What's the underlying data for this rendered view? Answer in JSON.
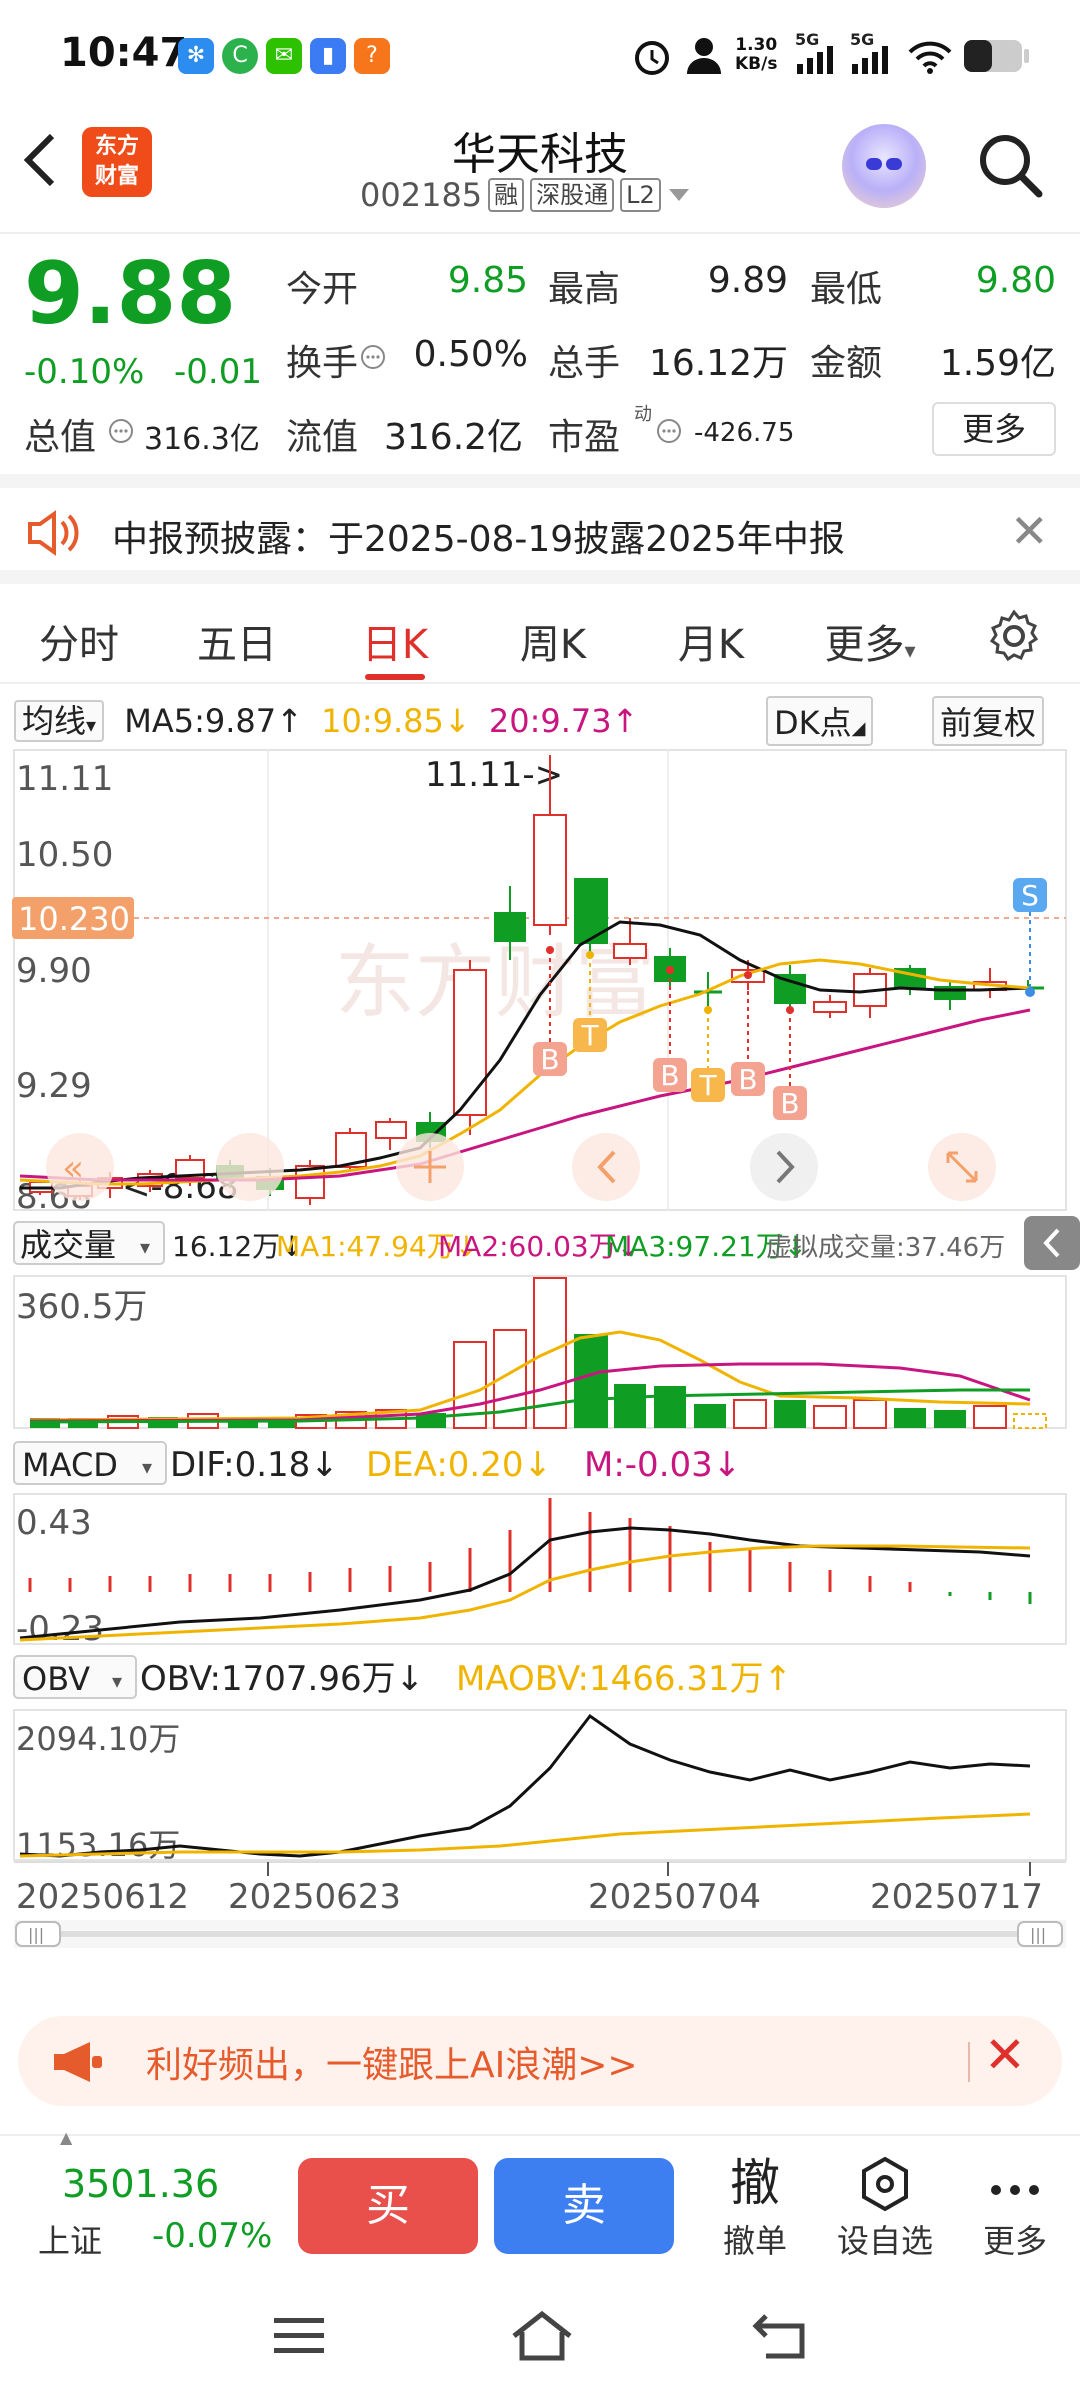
{
  "status_bar": {
    "time": "10:47",
    "net_speed": "1.30",
    "net_unit": "KB/s",
    "sig1": "5G",
    "sig2": "5G"
  },
  "header": {
    "logo_line1": "东方",
    "logo_line2": "财富",
    "name": "华天科技",
    "code": "002185",
    "tags": [
      "融",
      "深股通",
      "L2"
    ]
  },
  "quote": {
    "price": "9.88",
    "change_pct": "-0.10%",
    "change_abs": "-0.01",
    "fields": [
      {
        "label": "今开",
        "value": "9.85",
        "color": "green"
      },
      {
        "label": "最高",
        "value": "9.89",
        "color": "black"
      },
      {
        "label": "最低",
        "value": "9.80",
        "color": "green"
      },
      {
        "label": "换手",
        "value": "0.50%",
        "color": "black"
      },
      {
        "label": "总手",
        "value": "16.12万",
        "color": "black"
      },
      {
        "label": "金额",
        "value": "1.59亿",
        "color": "black"
      }
    ],
    "total_value_label": "总值",
    "total_value": "316.3亿",
    "float_label": "流值",
    "float_value": "316.2亿",
    "pe_label": "市盈",
    "pe_sup": "动",
    "pe_value": "-426.75",
    "more": "更多"
  },
  "notice": {
    "text": "中报预披露：于2025-08-19披露2025年中报"
  },
  "tabs": [
    "分时",
    "五日",
    "日K",
    "周K",
    "月K",
    "更多"
  ],
  "active_tab": 2,
  "ma_row": {
    "selector": "均线",
    "ma5": "MA5:9.87",
    "ma10": "10:9.85",
    "ma20": "20:9.73",
    "dk": "DK点",
    "adj": "前复权"
  },
  "kline": {
    "ymax_label": "11.11",
    "y2_label": "10.50",
    "y3_label": "9.90",
    "y4_label": "9.29",
    "y5_label": "8.68",
    "peak_note": "11.11->",
    "low_note": "<-8.68",
    "crosshair_price": "10.230",
    "markers": [
      "B",
      "T",
      "B",
      "T",
      "B",
      "B"
    ],
    "s_marker": "S"
  },
  "volume_row": {
    "selector": "成交量",
    "vol": "16.12万",
    "ma1": "MA1:47.94万",
    "ma2": "MA2:60.03万",
    "ma3": "MA3:97.21万",
    "virtual": "虚拟成交量:37.46万",
    "ymax": "360.5万"
  },
  "macd_row": {
    "selector": "MACD",
    "dif": "DIF:0.18",
    "dea": "DEA:0.20",
    "m": "M:-0.03",
    "ymax": "0.43",
    "ymin": "-0.23"
  },
  "obv_row": {
    "selector": "OBV",
    "obv": "OBV:1707.96万",
    "maobv": "MAOBV:1466.31万",
    "ymax": "2094.10万",
    "ymin": "1153.16万"
  },
  "dates": [
    "20250612",
    "20250623",
    "20250704",
    "20250717"
  ],
  "promo": {
    "text": "利好频出，一键跟上AI浪潮>>"
  },
  "bottom": {
    "index_value": "3501.36",
    "index_name": "上证",
    "index_change": "-0.07%",
    "buy": "买",
    "sell": "卖",
    "cancel_icon": "撤",
    "cancel": "撤单",
    "watch": "设自选",
    "more": "更多"
  },
  "colors": {
    "up": "#e0302b",
    "down": "#0f9d24",
    "ma5": "#111111",
    "ma10": "#f0b400",
    "ma20": "#c8157f",
    "accent": "#f04c1a"
  }
}
